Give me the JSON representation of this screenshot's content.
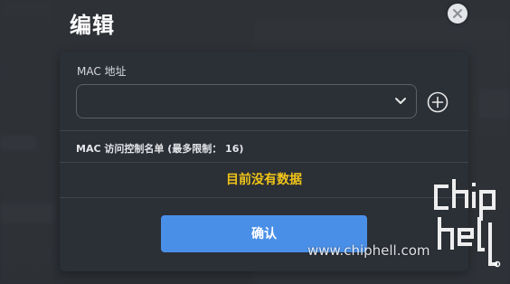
{
  "modal": {
    "title": "编辑",
    "field_label": "MAC 地址",
    "select_value": "",
    "list_title": "MAC 访问控制名单 (最多限制： 16)",
    "empty_text": "目前没有数据",
    "confirm_label": "确认"
  },
  "icons": {
    "close": "close-icon",
    "chevron": "chevron-down-icon",
    "add": "plus-circle-icon"
  },
  "watermark": {
    "text": "www.chiphell.com",
    "logo": "chiphell-logo"
  },
  "colors": {
    "accent": "#4a8fe7",
    "empty_text": "#f0c419",
    "card_bg": "#2b2f36"
  }
}
